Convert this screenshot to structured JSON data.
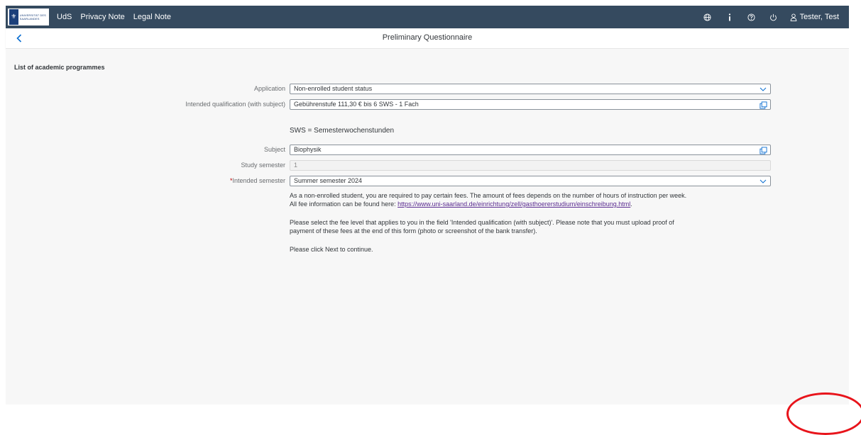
{
  "shellbar": {
    "logo_text": "UNIVERSITÄT DES SAARLANDES",
    "nav": [
      "UdS",
      "Privacy Note",
      "Legal Note"
    ],
    "user": "Tester, Test",
    "icons": [
      "globe-icon",
      "info-icon",
      "help-icon",
      "power-icon",
      "user-icon"
    ]
  },
  "page": {
    "title": "Preliminary Questionnaire"
  },
  "section": {
    "title": "List of academic programmes"
  },
  "form": {
    "application": {
      "label": "Application",
      "value": "Non-enrolled student status"
    },
    "qualification": {
      "label": "Intended qualification (with subject)",
      "value": "Gebührenstufe 111,30 € bis 6 SWS - 1 Fach"
    },
    "sws_note": "SWS = Semesterwochenstunden",
    "subject": {
      "label": "Subject",
      "value": "Biophysik"
    },
    "study_semester": {
      "label": "Study semester",
      "value": "1"
    },
    "intended_semester": {
      "required_mark": "*",
      "label": "Intended semester",
      "value": "Summer semester 2024"
    }
  },
  "info": {
    "p1_line1": "As a non-enrolled student, you are required to pay certain fees. The amount of fees depends on the number of hours of instruction per week.",
    "p1_line2_prefix": "All fee information can be found here: ",
    "p1_link": "https://www.uni-saarland.de/einrichtung/zell/gasthoererstudium/einschreibung.html",
    "p1_line2_suffix": ".",
    "p2_line1": "Please select the fee level that applies to you in the field 'Intended qualification (with subject)'. Please note that you must upload proof of",
    "p2_line2": "payment of these fees at the end of this form (photo or screenshot of the bank transfer).",
    "p3": "Please click Next to continue."
  },
  "colors": {
    "shellbar": "#354a5f",
    "content_bg": "#f7f7f7",
    "link": "#5b2c91",
    "required": "#bb0000",
    "annotation": "#e8141b"
  }
}
